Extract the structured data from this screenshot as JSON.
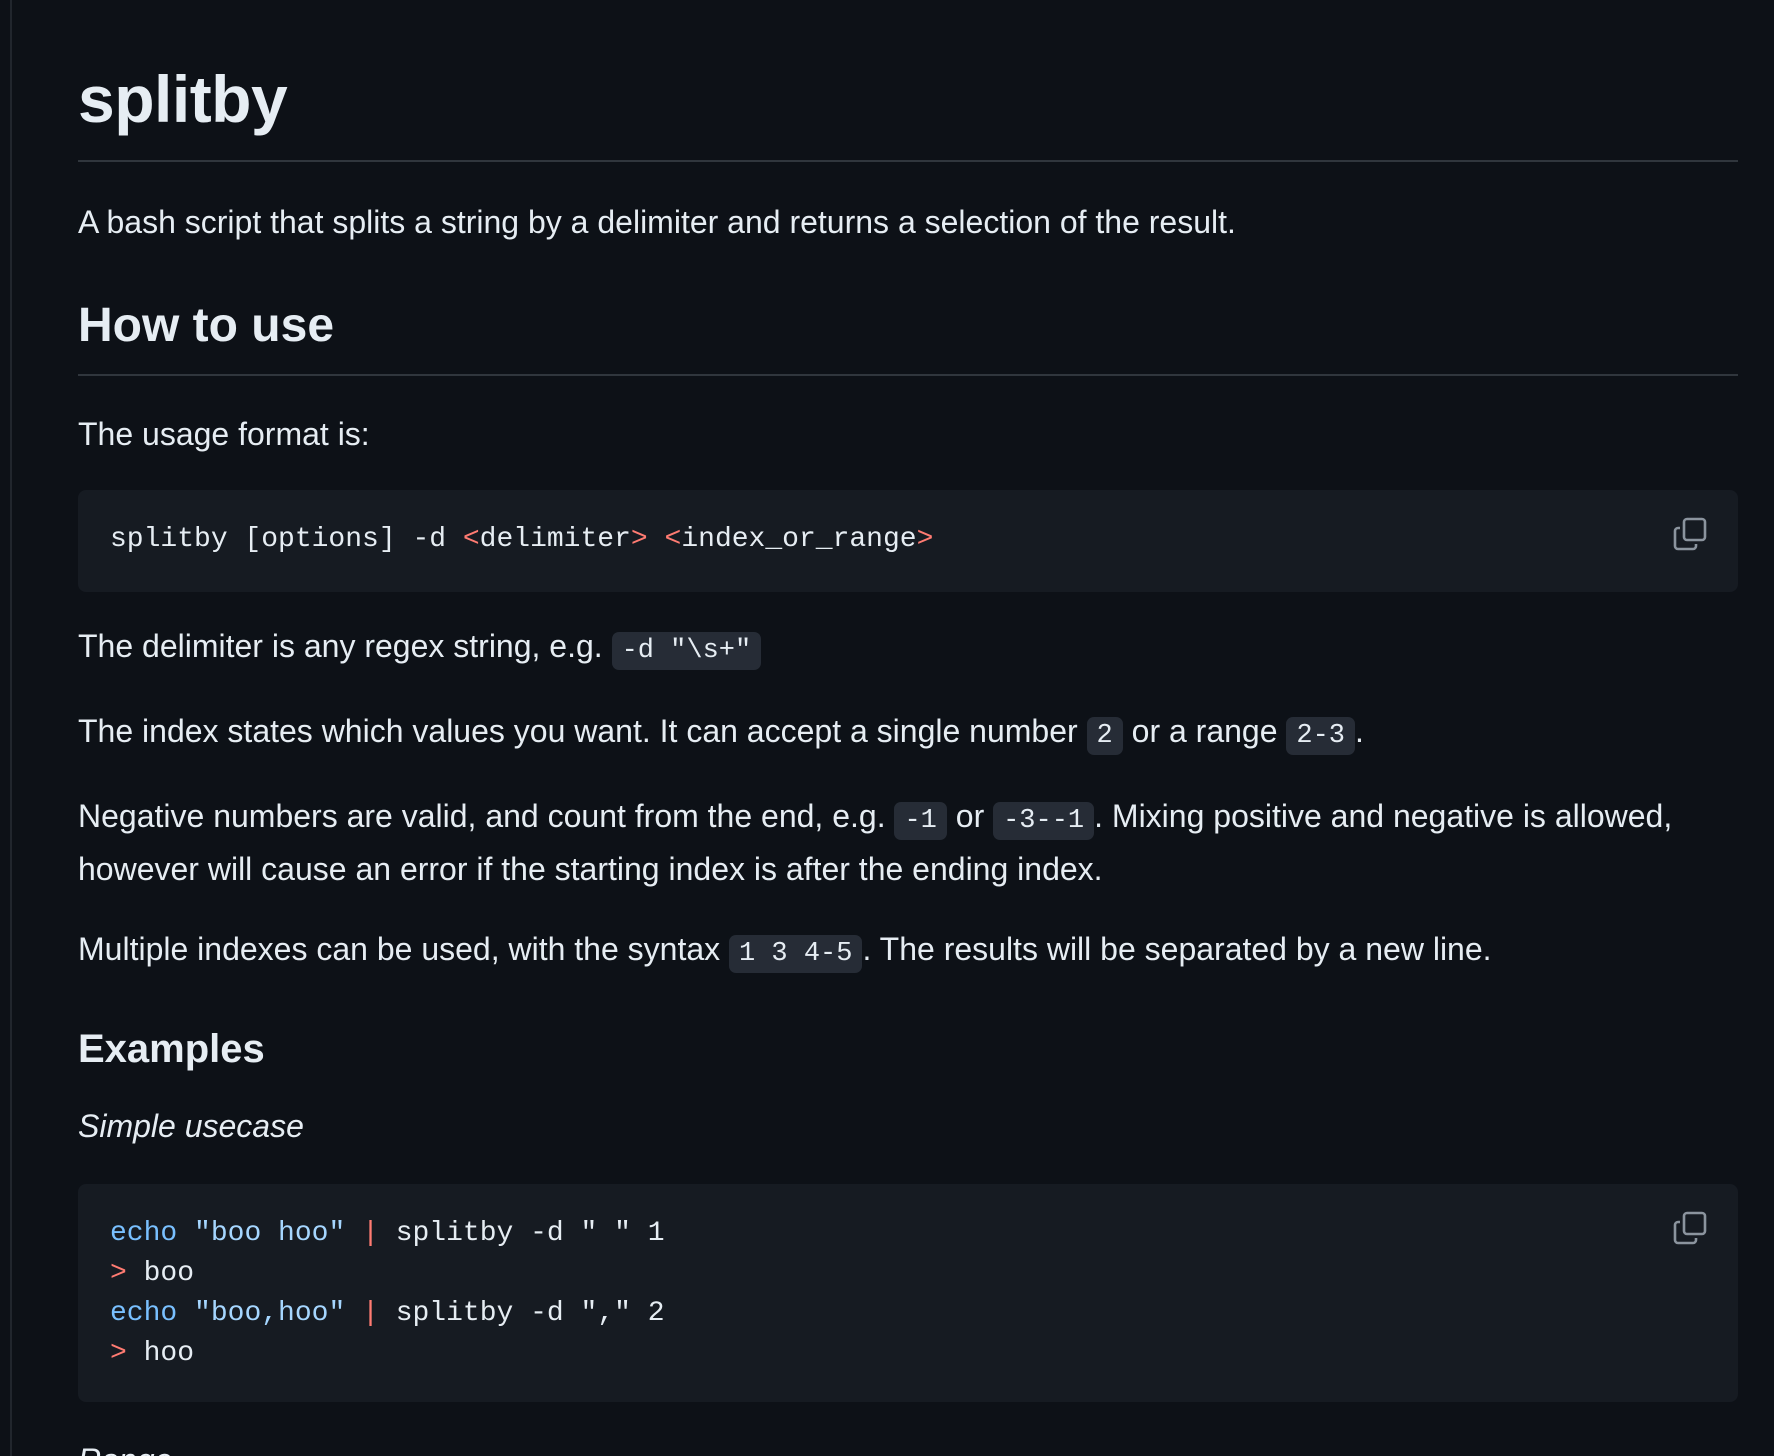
{
  "title": "splitby",
  "description": "A bash script that splits a string by a delimiter and returns a selection of the result.",
  "how_to_use": {
    "heading": "How to use",
    "usage_intro": "The usage format is:",
    "usage_code": {
      "cmd": "splitby [options] -d ",
      "lt1": "<",
      "arg1": "delimiter",
      "gt1": ">",
      "space": " ",
      "lt2": "<",
      "arg2": "index_or_range",
      "gt2": ">"
    },
    "delimiter_text": "The delimiter is any regex string, e.g. ",
    "delimiter_code": "-d \"\\s+\"",
    "index_text_1": "The index states which values you want. It can accept a single number ",
    "index_code_1": "2",
    "index_text_2": " or a range ",
    "index_code_2": "2-3",
    "index_text_3": ".",
    "negative_text_1": "Negative numbers are valid, and count from the end, e.g. ",
    "negative_code_1": "-1",
    "negative_text_2": " or ",
    "negative_code_2": "-3--1",
    "negative_text_3": ". Mixing positive and negative is allowed, however will cause an error if the starting index is after the ending index.",
    "multi_text_1": "Multiple indexes can be used, with the syntax ",
    "multi_code": "1 3 4-5",
    "multi_text_2": ". The results will be separated by a new line."
  },
  "examples": {
    "heading": "Examples",
    "simple_label": "Simple usecase",
    "code": {
      "l1_echo": "echo",
      "l1_str": "\"boo hoo\"",
      "l1_pipe": "|",
      "l1_rest": " splitby -d \" \" 1",
      "l2_prompt": ">",
      "l2_out": " boo",
      "l3_echo": "echo",
      "l3_str": "\"boo,hoo\"",
      "l3_pipe": "|",
      "l3_rest": " splitby -d \",\" 2",
      "l4_prompt": ">",
      "l4_out": " hoo"
    },
    "range_label": "Range"
  },
  "icons": {
    "copy": "copy-icon"
  },
  "colors": {
    "background": "#0d1117",
    "code_background": "#161b22",
    "inline_code_background": "#262c36",
    "text": "#e6edf3",
    "token_red": "#ff7b72",
    "token_blue": "#79c0ff",
    "border": "#30363d"
  }
}
